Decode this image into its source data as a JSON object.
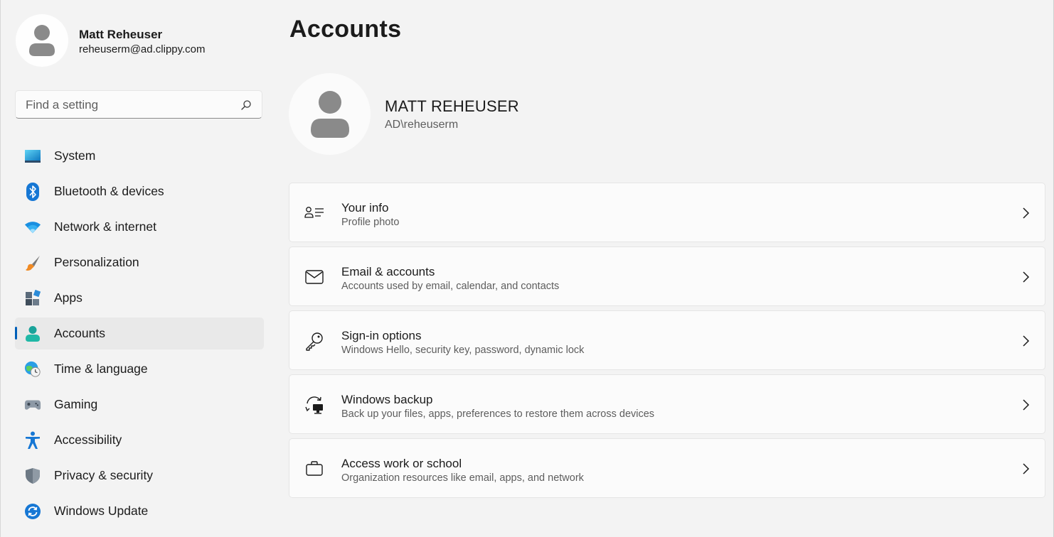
{
  "user": {
    "name": "Matt Reheuser",
    "email": "reheuserm@ad.clippy.com"
  },
  "search": {
    "placeholder": "Find a setting",
    "value": ""
  },
  "nav": {
    "items": [
      {
        "label": "System",
        "icon": "system-icon"
      },
      {
        "label": "Bluetooth & devices",
        "icon": "bluetooth-icon"
      },
      {
        "label": "Network & internet",
        "icon": "wifi-icon"
      },
      {
        "label": "Personalization",
        "icon": "paintbrush-icon"
      },
      {
        "label": "Apps",
        "icon": "apps-icon"
      },
      {
        "label": "Accounts",
        "icon": "accounts-icon",
        "selected": true
      },
      {
        "label": "Time & language",
        "icon": "globe-clock-icon"
      },
      {
        "label": "Gaming",
        "icon": "gamepad-icon"
      },
      {
        "label": "Accessibility",
        "icon": "accessibility-icon"
      },
      {
        "label": "Privacy & security",
        "icon": "shield-icon"
      },
      {
        "label": "Windows Update",
        "icon": "update-icon"
      }
    ]
  },
  "main": {
    "title": "Accounts",
    "profile": {
      "name": "MATT REHEUSER",
      "account": "AD\\reheuserm"
    },
    "cards": [
      {
        "title": "Your info",
        "description": "Profile photo",
        "icon": "contact-card-icon"
      },
      {
        "title": "Email & accounts",
        "description": "Accounts used by email, calendar, and contacts",
        "icon": "mail-icon"
      },
      {
        "title": "Sign-in options",
        "description": "Windows Hello, security key, password, dynamic lock",
        "icon": "key-icon"
      },
      {
        "title": "Windows backup",
        "description": "Back up your files, apps, preferences to restore them across devices",
        "icon": "backup-icon"
      },
      {
        "title": "Access work or school",
        "description": "Organization resources like email, apps, and network",
        "icon": "briefcase-icon"
      }
    ]
  },
  "colors": {
    "accent": "#005fb8",
    "background": "#f3f3f3",
    "card": "#fbfbfb",
    "selected_nav": "#e9e9e9"
  }
}
